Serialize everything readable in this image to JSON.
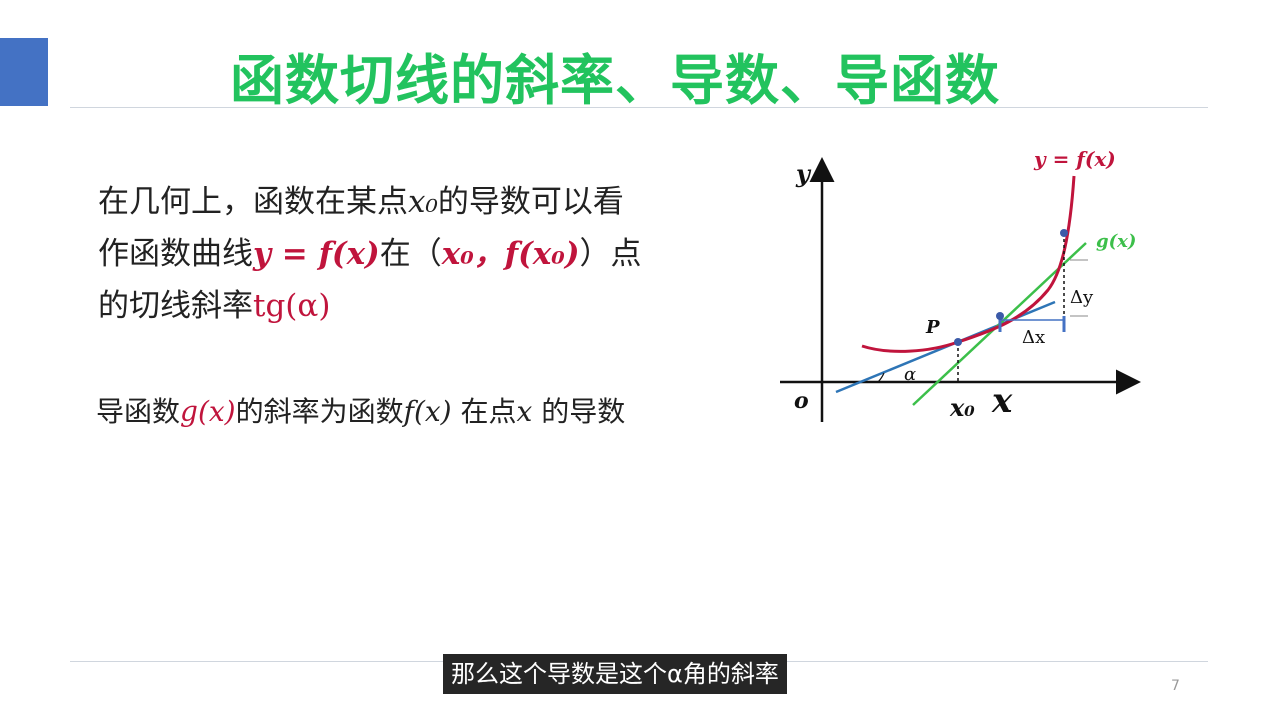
{
  "slide": {
    "title": "函数切线的斜率、导数、导函数",
    "page_number": "7",
    "caption": "那么这个导数是这个α角的斜率"
  },
  "paragraph": {
    "l1a": "在几何上，函数在某点",
    "x0": "x₀",
    "l1b": "的导数可以看",
    "l2a": "作函数曲线",
    "eq": "y = f(x)",
    "l2b": "在（",
    "pt": "x₀，f(x₀)",
    "l2c": "）点",
    "l3a": "的切线斜率",
    "tg": "tg(α)"
  },
  "statement": {
    "a": "导函数",
    "g": "g(x)",
    "b": "的斜率为函数",
    "f": "f(x)",
    "c": " 在点",
    "x": "x",
    "d": " 的导数"
  },
  "diagram": {
    "y_axis": "y",
    "origin": "o",
    "x_axis": "x",
    "curve_label": "y = f(x)",
    "tangent_label": "g(x)",
    "point_label": "P",
    "x0_label": "x₀",
    "alpha": "α",
    "dy": "Δy",
    "dx": "Δx",
    "colors": {
      "curve": "#c0143c",
      "tangent_p": "#2e75b6",
      "secant": "#3cbf4a",
      "title": "#22c35e",
      "accent": "#4472c4"
    }
  }
}
